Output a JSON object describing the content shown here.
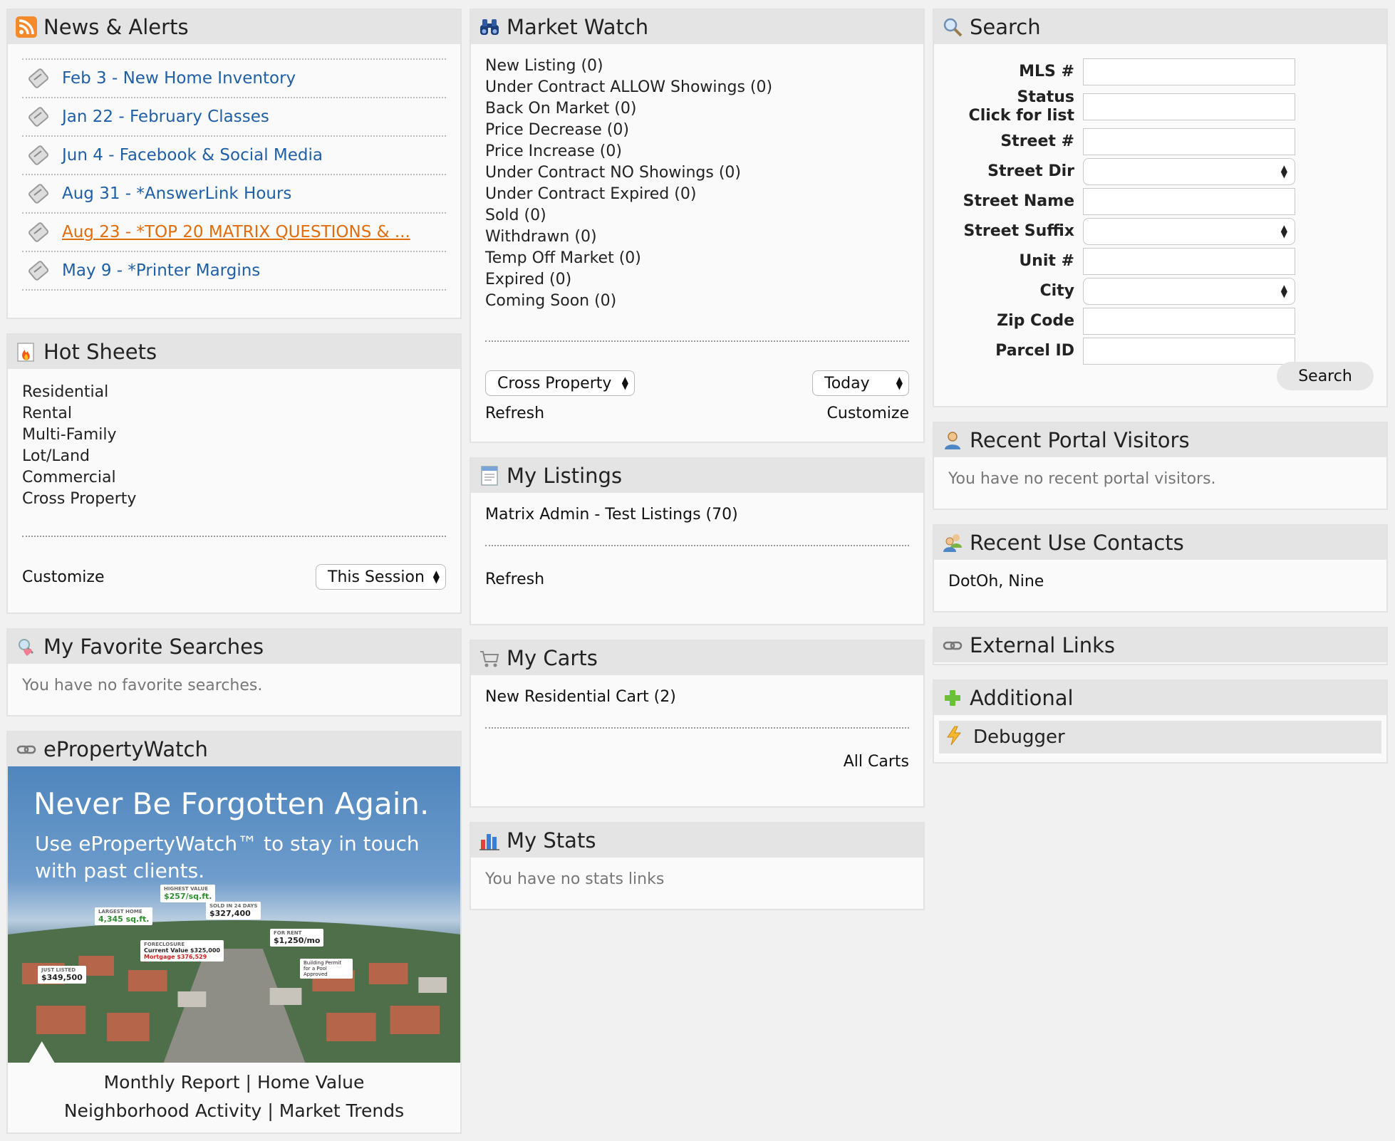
{
  "news": {
    "title": "News & Alerts",
    "items": [
      {
        "text": "Feb 3 - New Home Inventory",
        "visited": false
      },
      {
        "text": "Jan 22 - February Classes",
        "visited": false
      },
      {
        "text": "Jun 4 - Facebook & Social Media",
        "visited": false
      },
      {
        "text": "Aug 31 - *AnswerLink Hours",
        "visited": false
      },
      {
        "text": "Aug 23 - *TOP 20 MATRIX QUESTIONS & ...",
        "visited": true
      },
      {
        "text": "May 9 - *Printer Margins",
        "visited": false
      }
    ]
  },
  "hot_sheets": {
    "title": "Hot Sheets",
    "items": [
      "Residential",
      "Rental",
      "Multi-Family",
      "Lot/Land",
      "Commercial",
      "Cross Property"
    ],
    "customize_label": "Customize",
    "session_select": "This Session"
  },
  "favorites": {
    "title": "My Favorite Searches",
    "empty": "You have no favorite searches."
  },
  "epw": {
    "title": "ePropertyWatch",
    "headline": "Never Be Forgotten Again.",
    "subline": "Use ePropertyWatch™ to stay in touch with past clients.",
    "tags": {
      "highest_value_label": "HIGHEST VALUE",
      "highest_value": "$257/sq.ft.",
      "largest_home_label": "LARGEST HOME",
      "largest_home": "4,345 sq.ft.",
      "sold_label": "SOLD IN 24 DAYS",
      "sold": "$327,400",
      "for_rent_label": "FOR RENT",
      "for_rent": "$1,250/mo",
      "foreclosure_label": "FORECLOSURE",
      "foreclosure_value": "Current Value $325,000",
      "foreclosure_mortgage": "Mortgage $376,529",
      "just_listed_label": "JUST LISTED",
      "just_listed": "$349,500",
      "permit": "Building Permit for a Pool Approved"
    },
    "links_row1": [
      "Monthly Report",
      "Home Value"
    ],
    "links_row2": [
      "Neighborhood Activity",
      "Market Trends"
    ],
    "separator": "|"
  },
  "market_watch": {
    "title": "Market Watch",
    "items": [
      "New Listing (0)",
      "Under Contract ALLOW Showings (0)",
      "Back On Market (0)",
      "Price Decrease (0)",
      "Price Increase (0)",
      "Under Contract NO Showings (0)",
      "Under Contract Expired (0)",
      "Sold (0)",
      "Withdrawn (0)",
      "Temp Off Market (0)",
      "Expired (0)",
      "Coming Soon (0)"
    ],
    "property_select": "Cross Property",
    "period_select": "Today",
    "refresh_label": "Refresh",
    "customize_label": "Customize"
  },
  "my_listings": {
    "title": "My Listings",
    "item": "Matrix Admin - Test Listings (70)",
    "refresh_label": "Refresh"
  },
  "my_carts": {
    "title": "My Carts",
    "item": "New Residential Cart (2)",
    "all_label": "All Carts"
  },
  "my_stats": {
    "title": "My Stats",
    "empty": "You have no stats links"
  },
  "search": {
    "title": "Search",
    "fields": {
      "mls": "MLS #",
      "status_1": "Status",
      "status_2": "Click for list",
      "street_num": "Street #",
      "street_dir": "Street Dir",
      "street_name": "Street Name",
      "street_suffix": "Street Suffix",
      "unit": "Unit #",
      "city": "City",
      "zip": "Zip Code",
      "parcel": "Parcel ID"
    },
    "button": "Search"
  },
  "portal_visitors": {
    "title": "Recent Portal Visitors",
    "empty": "You have no recent portal visitors."
  },
  "contacts": {
    "title": "Recent Use Contacts",
    "item": "DotOh, Nine"
  },
  "external_links": {
    "title": "External Links"
  },
  "additional": {
    "title": "Additional",
    "item": "Debugger"
  },
  "colors": {
    "link": "#1f5fa6",
    "visited_link": "#e36c0a",
    "panel_header": "#e4e4e4",
    "page_bg": "#f1f1f1"
  }
}
